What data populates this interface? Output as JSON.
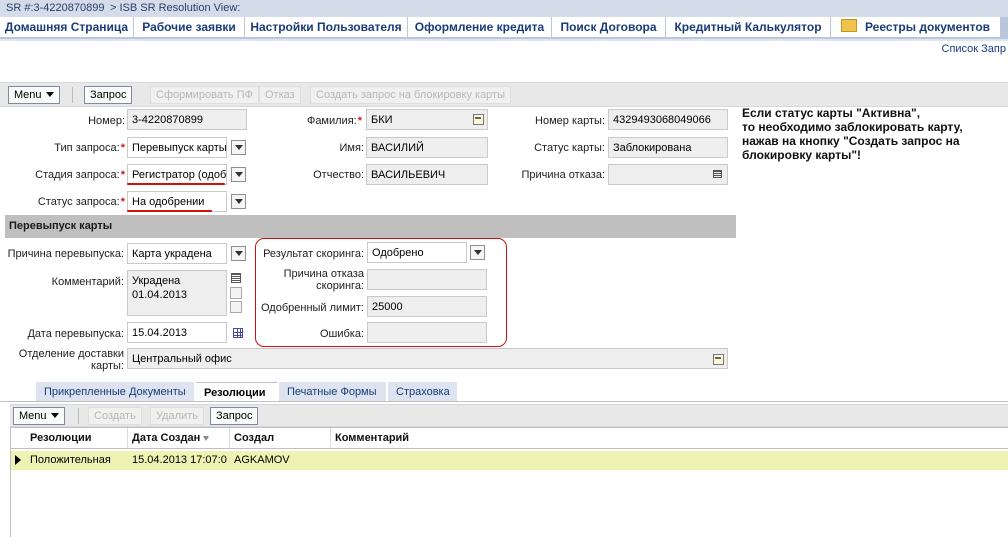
{
  "window": {
    "sr_label": "SR #:3-4220870899",
    "view_label": "> ISB SR Resolution View:"
  },
  "nav": {
    "tabs": [
      {
        "label": "Домашняя Страница"
      },
      {
        "label": "Рабочие заявки"
      },
      {
        "label": "Настройки Пользователя"
      },
      {
        "label": "Оформление кредита"
      },
      {
        "label": "Поиск Договора"
      },
      {
        "label": "Кредитный Калькулятор"
      },
      {
        "label": "Реестры документов",
        "icon": "folder-icon"
      }
    ],
    "list_link": "Список Запр"
  },
  "toolbar": {
    "menu": "Menu",
    "request": "Запрос",
    "form_pf": "Сформировать ПФ",
    "reject": "Отказ",
    "block_request": "Создать запрос на блокировку карты"
  },
  "form": {
    "number": {
      "label": "Номер:",
      "value": "3-4220870899"
    },
    "request_type": {
      "label": "Тип запроса:",
      "value": "Перевыпуск карты"
    },
    "stage": {
      "label": "Стадия запроса:",
      "value": "Регистратор (одоб"
    },
    "status": {
      "label": "Статус запроса:",
      "value": "На одобрении"
    },
    "last_name": {
      "label": "Фамилия:",
      "value": "БКИ"
    },
    "first_name": {
      "label": "Имя:",
      "value": "ВАСИЛИЙ"
    },
    "patronymic": {
      "label": "Отчество:",
      "value": "ВАСИЛЬЕВИЧ"
    },
    "card_number": {
      "label": "Номер карты:",
      "value": "4329493068049066"
    },
    "card_status": {
      "label": "Статус карты:",
      "value": "Заблокирована"
    },
    "reject_reason": {
      "label": "Причина отказа:",
      "value": ""
    }
  },
  "notice": "Если статус карты \"Активна\",\n то необходимо заблокировать карту,\n нажав на кнопку \"Создать запрос на\n блокировку карты\"!",
  "reissue": {
    "section_title": "Перевыпуск карты",
    "reason": {
      "label": "Причина перевыпуска:",
      "value": "Карта украдена"
    },
    "comment": {
      "label": "Комментарий:",
      "value_line1": "Украдена",
      "value_line2": "01.04.2013"
    },
    "reissue_date": {
      "label": "Дата перевыпуска:",
      "value": "15.04.2013"
    },
    "delivery_office": {
      "label_line1": "Отделение доставки",
      "label_line2": "карты:",
      "value": "Центральный офис"
    },
    "scoring_result": {
      "label": "Результат скоринга:",
      "value": "Одобрено"
    },
    "scoring_reject_reason": {
      "label_line1": "Причина отказа",
      "label_line2": "скоринга:",
      "value": ""
    },
    "approved_limit": {
      "label": "Одобренный лимит:",
      "value": "25000"
    },
    "error": {
      "label": "Ошибка:",
      "value": ""
    }
  },
  "subtabs": [
    {
      "label": "Прикрепленные Документы"
    },
    {
      "label": "Резолюции",
      "active": true
    },
    {
      "label": "Печатные Формы"
    },
    {
      "label": "Страховка"
    }
  ],
  "toolbar2": {
    "menu": "Menu",
    "create": "Создать",
    "delete": "Удалить",
    "request": "Запрос"
  },
  "resolutions": {
    "columns": [
      "Резолюции",
      "Дата Создан",
      "Создал",
      "Комментарий"
    ],
    "rows": [
      {
        "resolution": "Положительная",
        "created": "15.04.2013 17:07:0",
        "author": "AGKAMOV",
        "comment": ""
      }
    ]
  },
  "colors": {
    "accent_red": "#cc1111",
    "nav_blue": "#1a3a7a",
    "row_highlight": "#eef2b2"
  }
}
